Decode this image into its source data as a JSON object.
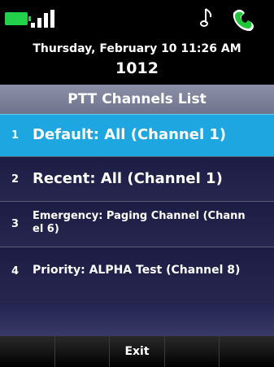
{
  "status": {
    "battery_color": "#22d14a",
    "icons": [
      "battery-icon",
      "signal-bars-icon",
      "music-note-icon",
      "phone-handset-icon"
    ]
  },
  "header": {
    "datetime": "Thursday, February 10 11:26 AM",
    "extension": "1012"
  },
  "title": "PTT Channels List",
  "items": [
    {
      "number": "1",
      "label": "Default: All (Channel 1)",
      "selected": true
    },
    {
      "number": "2",
      "label": "Recent: All (Channel 1)",
      "selected": false
    },
    {
      "number": "3",
      "label_line1": "Emergency: Paging Channel (Chann",
      "label_line2": "el 6)",
      "selected": false
    },
    {
      "number": "4",
      "label": "Priority: ALPHA Test (Channel 8)",
      "selected": false
    }
  ],
  "softkeys": [
    "",
    "",
    "Exit",
    "",
    ""
  ],
  "colors": {
    "selected": "#1ea6e0",
    "list_bg": "#1c1c45",
    "title_bar": "#7d8199"
  }
}
